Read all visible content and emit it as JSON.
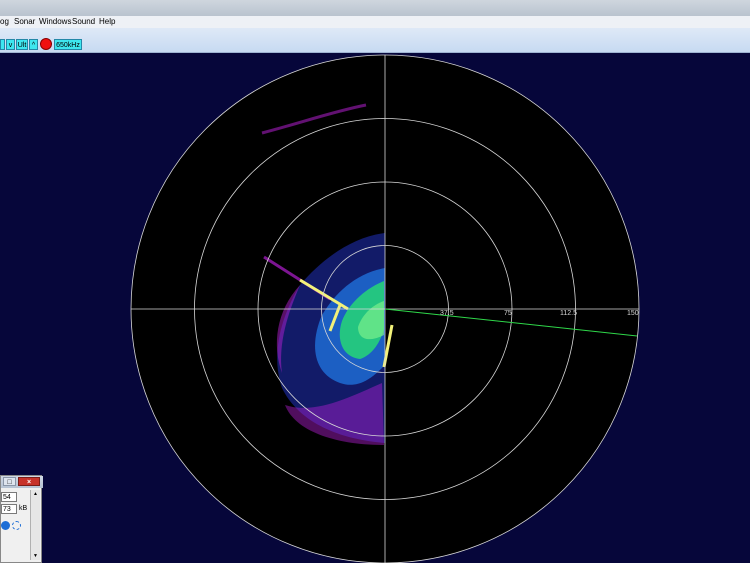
{
  "menu": {
    "items": [
      "og",
      "Sonar",
      "Windows",
      "Sound",
      "Help"
    ]
  },
  "toolbar": {
    "gain_down_label": "v",
    "range_label": "Ult",
    "gain_up_label": "^",
    "frequency_label": "650kHz"
  },
  "sonar": {
    "range_labels": [
      "37.5",
      "75",
      "112.5",
      "150"
    ],
    "colors": {
      "background": "#06063a",
      "ring": "#d8d8d8",
      "heading_line": "#2fd84a",
      "echo_strong": "#f2f27a",
      "echo_mid": "#26d07a",
      "echo_low": "#1f6bd4",
      "echo_faint": "#b21fd0"
    }
  },
  "panel": {
    "min_label": "□",
    "close_label": "×",
    "field_1": "54",
    "field_2": "73",
    "field_2_unit": "kB",
    "scroll_up": "▲",
    "scroll_down": "▼"
  }
}
